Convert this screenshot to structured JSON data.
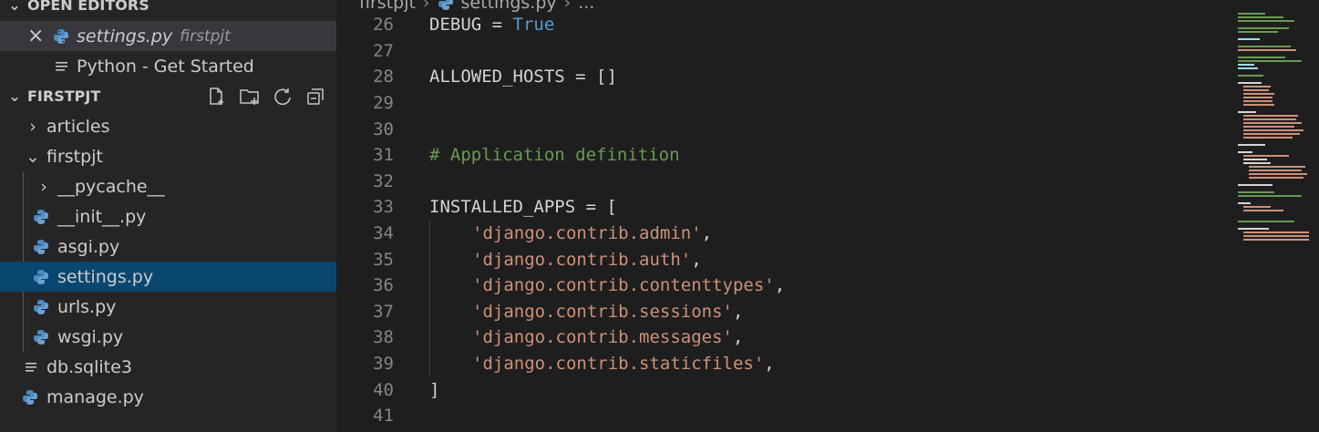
{
  "sidebar": {
    "open_editors_title": "OPEN EDITORS",
    "open_editors": [
      {
        "name": "settings.py",
        "desc": "firstpjt",
        "icon": "python-icon",
        "close": "×"
      },
      {
        "name": "Python - Get Started",
        "icon": "list-icon"
      }
    ],
    "project_title": "FIRSTPJT",
    "toolbar_icons": [
      "new-file-icon",
      "new-folder-icon",
      "refresh-icon",
      "collapse-all-icon"
    ],
    "tree": {
      "articles": "articles",
      "firstpjt": "firstpjt",
      "pycache": "__pycache__",
      "init": "__init__.py",
      "asgi": "asgi.py",
      "settings": "settings.py",
      "urls": "urls.py",
      "wsgi": "wsgi.py",
      "db": "db.sqlite3",
      "manage": "manage.py"
    }
  },
  "editor": {
    "breadcrumb": {
      "part1": "firstpjt",
      "part2": "settings.py",
      "part3": "..."
    },
    "lines": [
      {
        "n": "26",
        "a": "DEBUG = ",
        "b": "True"
      },
      {
        "n": "27"
      },
      {
        "n": "28",
        "a": "ALLOWED_HOSTS = []"
      },
      {
        "n": "29"
      },
      {
        "n": "30"
      },
      {
        "n": "31",
        "c": "# Application definition"
      },
      {
        "n": "32"
      },
      {
        "n": "33",
        "a": "INSTALLED_APPS = ["
      },
      {
        "n": "34",
        "s": "'django.contrib.admin'",
        "p": ","
      },
      {
        "n": "35",
        "s": "'django.contrib.auth'",
        "p": ","
      },
      {
        "n": "36",
        "s": "'django.contrib.contenttypes'",
        "p": ","
      },
      {
        "n": "37",
        "s": "'django.contrib.sessions'",
        "p": ","
      },
      {
        "n": "38",
        "s": "'django.contrib.messages'",
        "p": ","
      },
      {
        "n": "39",
        "s": "'django.contrib.staticfiles'",
        "p": ","
      },
      {
        "n": "40",
        "a": "]"
      },
      {
        "n": "41"
      }
    ]
  },
  "colors": {
    "sidebar_bg": "#252526",
    "editor_bg": "#1e1e1e",
    "selection": "#094771",
    "python_icon": "#4b8bbe",
    "keyword": "#569cd6",
    "string": "#ce9178",
    "comment": "#6a9955"
  }
}
